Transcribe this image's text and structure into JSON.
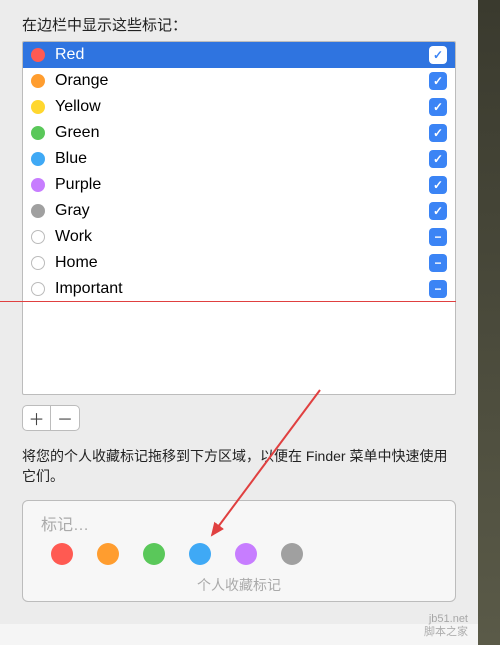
{
  "heading": "在边栏中显示这些标记：",
  "tags": [
    {
      "label": "Red",
      "color": "#ff5a52",
      "hollow": false,
      "state": "check",
      "selected": true
    },
    {
      "label": "Orange",
      "color": "#ff9d2f",
      "hollow": false,
      "state": "check",
      "selected": false
    },
    {
      "label": "Yellow",
      "color": "#ffd72f",
      "hollow": false,
      "state": "check",
      "selected": false
    },
    {
      "label": "Green",
      "color": "#5ac85a",
      "hollow": false,
      "state": "check",
      "selected": false
    },
    {
      "label": "Blue",
      "color": "#3fa9f5",
      "hollow": false,
      "state": "check",
      "selected": false
    },
    {
      "label": "Purple",
      "color": "#c77dff",
      "hollow": false,
      "state": "check",
      "selected": false
    },
    {
      "label": "Gray",
      "color": "#a0a0a0",
      "hollow": false,
      "state": "check",
      "selected": false
    },
    {
      "label": "Work",
      "color": "",
      "hollow": true,
      "state": "minus",
      "selected": false
    },
    {
      "label": "Home",
      "color": "",
      "hollow": true,
      "state": "minus",
      "selected": false
    },
    {
      "label": "Important",
      "color": "",
      "hollow": true,
      "state": "minus",
      "selected": false
    }
  ],
  "plus": "＋",
  "minus": "－",
  "hint": "将您的个人收藏标记拖移到下方区域，以便在 Finder 菜单中快速使用它们。",
  "favorites": {
    "label": "标记…",
    "caption": "个人收藏标记",
    "dots": [
      "#ff5a52",
      "#ff9d2f",
      "#5ac85a",
      "#3fa9f5",
      "#c77dff",
      "#a0a0a0"
    ]
  },
  "watermark": {
    "line1": "jb51.net",
    "line2": "脚本之家"
  },
  "colors": {
    "selection": "#2f74e0",
    "accent": "#3b84f5",
    "annotation": "#e04040"
  }
}
